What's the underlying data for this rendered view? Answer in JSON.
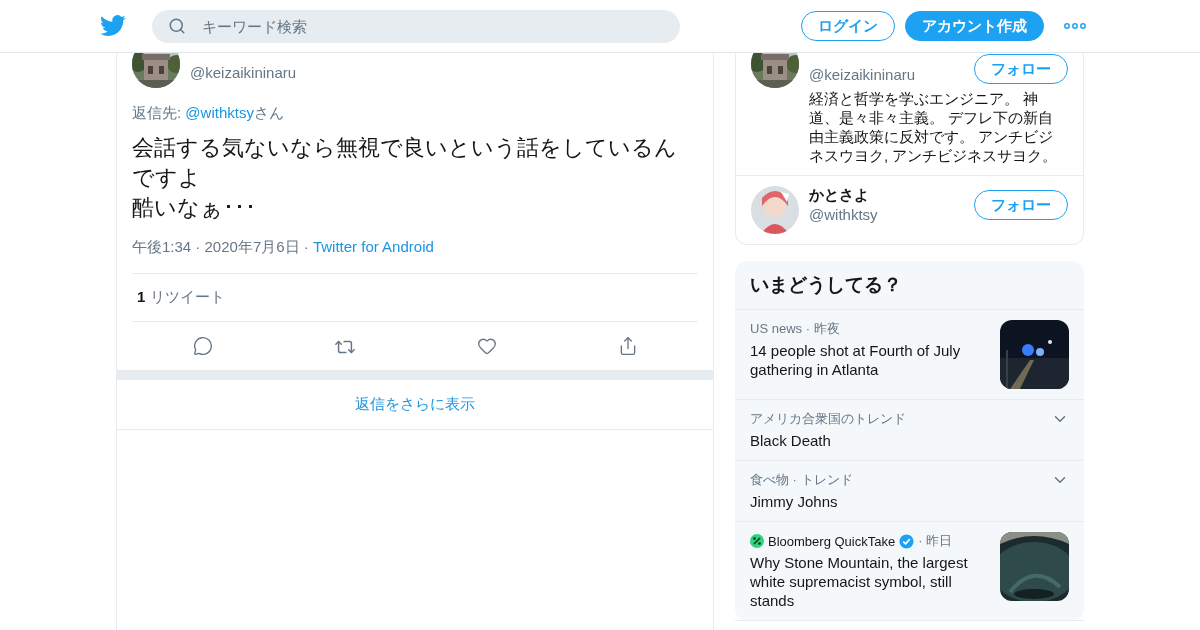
{
  "header": {
    "search_placeholder": "キーワード検索",
    "buttons": [
      {
        "label": "ログイン",
        "kind": "outline"
      },
      {
        "label": "アカウント作成",
        "kind": "filled"
      }
    ]
  },
  "tweet": {
    "handle": "@keizaikininaru",
    "reply_prefix": "返信先: ",
    "reply_to": "@withktsy",
    "reply_suffix": "さん",
    "text_lines": [
      "会話する気ないなら無視で良いという話をしているんですよ",
      "酷いなぁ･･･"
    ],
    "meta": "午後1:34 · 2020年7月6日 ·",
    "source": "Twitter for Android",
    "retweet_count": "1",
    "retweet_label": "リツイート"
  },
  "more_replies": "返信をさらに表示",
  "users": [
    {
      "handle": "@keizaikininaru",
      "bio": "経済と哲学を学ぶエンジニア。 神道、是々非々主義。 デフレ下の新自由主義政策に反対です。 アンチビジネスウヨク, アンチビジネスサヨク。",
      "follow_label": "フォロー"
    },
    {
      "name": "かとさよ",
      "handle": "@withktsy",
      "follow_label": "フォロー"
    }
  ],
  "trends": {
    "title": "いまどうしてる？",
    "items": [
      {
        "kind": "news",
        "meta": "US news · 昨夜",
        "title": "14 people shot at Fourth of July gathering in Atlanta"
      },
      {
        "kind": "trend",
        "meta": "アメリカ合衆国のトレンド",
        "title": "Black Death"
      },
      {
        "kind": "trend",
        "meta": "食べ物 · トレンド",
        "title": "Jimmy Johns"
      },
      {
        "kind": "account",
        "source": "Bloomberg QuickTake",
        "verified": true,
        "meta": "· 昨日",
        "title": "Why Stone Mountain, the largest white supremacist symbol, still stands"
      }
    ]
  }
}
